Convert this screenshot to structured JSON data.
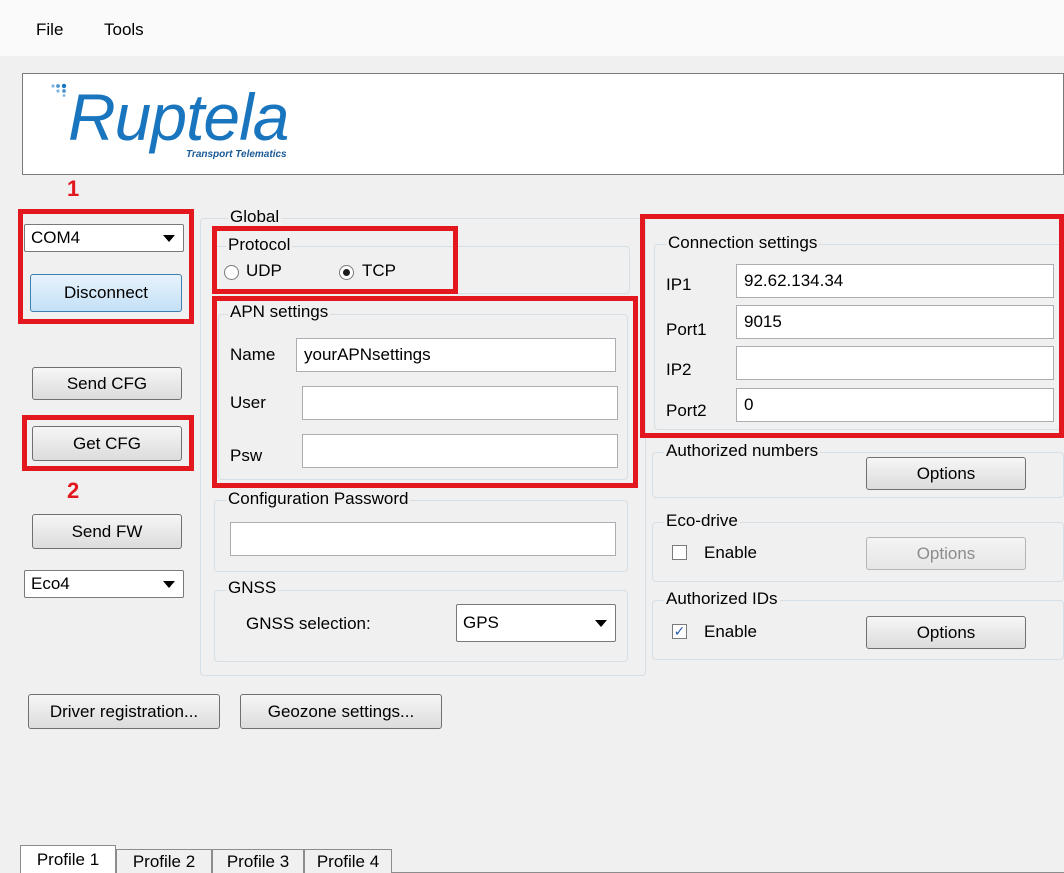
{
  "menu": {
    "file": "File",
    "tools": "Tools"
  },
  "logo": {
    "name": "Ruptela",
    "tagline": "Transport Telematics"
  },
  "annotations": {
    "n1": "1",
    "n2": "2"
  },
  "left": {
    "port": "COM4",
    "disconnect": "Disconnect",
    "send_cfg": "Send CFG",
    "get_cfg": "Get CFG",
    "send_fw": "Send FW",
    "device": "Eco4"
  },
  "global": {
    "title": "Global",
    "protocol": {
      "title": "Protocol",
      "udp": "UDP",
      "tcp": "TCP",
      "selected": "TCP"
    },
    "apn": {
      "title": "APN settings",
      "name_label": "Name",
      "name_value": "yourAPNsettings",
      "user_label": "User",
      "user_value": "",
      "psw_label": "Psw",
      "psw_value": ""
    },
    "config_password": {
      "title": "Configuration Password",
      "value": ""
    },
    "gnss": {
      "title": "GNSS",
      "label": "GNSS selection:",
      "value": "GPS"
    }
  },
  "connection": {
    "title": "Connection settings",
    "ip1_label": "IP1",
    "ip1_value": "92.62.134.34",
    "port1_label": "Port1",
    "port1_value": "9015",
    "ip2_label": "IP2",
    "ip2_value": "",
    "port2_label": "Port2",
    "port2_value": "0"
  },
  "authorized_numbers": {
    "title": "Authorized numbers",
    "options": "Options"
  },
  "eco_drive": {
    "title": "Eco-drive",
    "enable": "Enable",
    "checked": false,
    "options": "Options"
  },
  "authorized_ids": {
    "title": "Authorized IDs",
    "enable": "Enable",
    "checked": true,
    "options": "Options"
  },
  "bottom": {
    "driver_registration": "Driver registration...",
    "geozone_settings": "Geozone settings..."
  },
  "tabs": [
    "Profile 1",
    "Profile 2",
    "Profile 3",
    "Profile 4"
  ]
}
